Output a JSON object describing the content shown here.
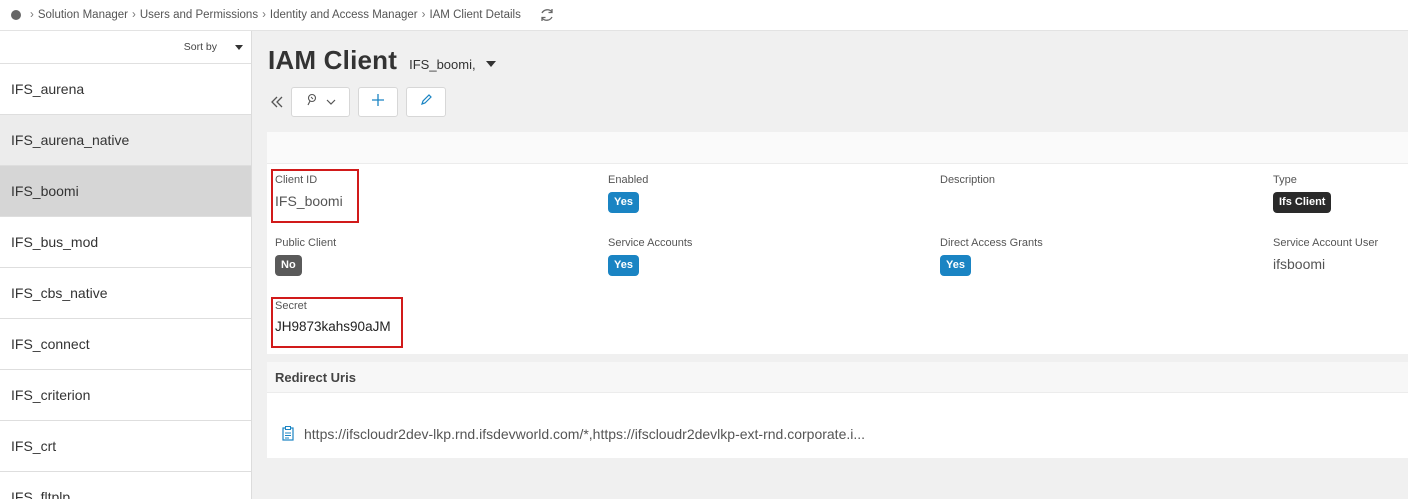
{
  "breadcrumb": {
    "items": [
      "Solution Manager",
      "Users and Permissions",
      "Identity and Access Manager",
      "IAM Client Details"
    ]
  },
  "sidebar": {
    "sort_label": "Sort by",
    "items": [
      {
        "label": "IFS_aurena"
      },
      {
        "label": "IFS_aurena_native"
      },
      {
        "label": "IFS_boomi"
      },
      {
        "label": "IFS_bus_mod"
      },
      {
        "label": "IFS_cbs_native"
      },
      {
        "label": "IFS_connect"
      },
      {
        "label": "IFS_criterion"
      },
      {
        "label": "IFS_crt"
      },
      {
        "label": "IFS_fltplp"
      }
    ],
    "selected_index": 2
  },
  "page": {
    "title": "IAM Client",
    "record_selector": "IFS_boomi,"
  },
  "details": {
    "client_id": {
      "label": "Client ID",
      "value": "IFS_boomi"
    },
    "enabled": {
      "label": "Enabled",
      "value": "Yes"
    },
    "description": {
      "label": "Description",
      "value": ""
    },
    "type": {
      "label": "Type",
      "value": "Ifs Client"
    },
    "public_client": {
      "label": "Public Client",
      "value": "No"
    },
    "service_accounts": {
      "label": "Service Accounts",
      "value": "Yes"
    },
    "direct_access_grants": {
      "label": "Direct Access Grants",
      "value": "Yes"
    },
    "service_account_user": {
      "label": "Service Account User",
      "value": "ifsboomi"
    },
    "secret": {
      "label": "Secret",
      "value": "JH9873kahs90aJM"
    }
  },
  "redirect": {
    "title": "Redirect Uris",
    "value": "https://ifscloudr2dev-lkp.rnd.ifsdevworld.com/*,https://ifscloudr2devlkp-ext-rnd.corporate.i..."
  },
  "colors": {
    "accent": "#1a84c3",
    "highlight": "#d11a1a",
    "badge_no": "#5a5a5a",
    "badge_type": "#2a2a2a"
  },
  "icons": {
    "home": "home-dot-icon",
    "refresh": "refresh-icon",
    "collapse": "double-chevron-left-icon",
    "menu": "pin-icon",
    "new": "plus-icon",
    "edit": "pencil-icon",
    "redirect": "document-icon"
  }
}
